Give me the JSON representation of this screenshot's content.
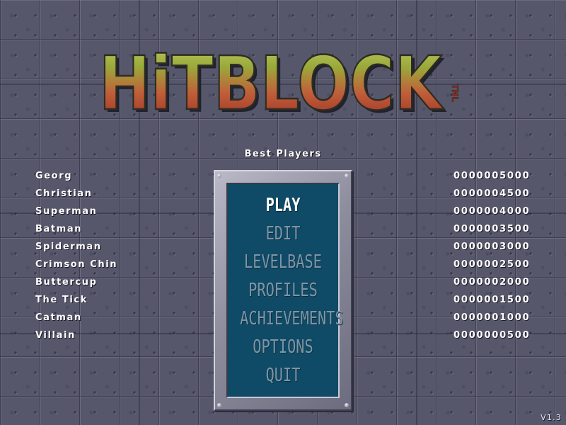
{
  "game": {
    "title": "HiTBLOCK",
    "tag": "TNL",
    "version": "V1.3"
  },
  "highscores": {
    "title": "Best Players",
    "entries": [
      {
        "name": "Georg",
        "score": "0000005000"
      },
      {
        "name": "Christian",
        "score": "0000004500"
      },
      {
        "name": "Superman",
        "score": "0000004000"
      },
      {
        "name": "Batman",
        "score": "0000003500"
      },
      {
        "name": "Spiderman",
        "score": "0000003000"
      },
      {
        "name": "Crimson Chin",
        "score": "0000002500"
      },
      {
        "name": "Buttercup",
        "score": "0000002000"
      },
      {
        "name": "The Tick",
        "score": "0000001500"
      },
      {
        "name": "Catman",
        "score": "0000001000"
      },
      {
        "name": "Villain",
        "score": "0000000500"
      }
    ]
  },
  "menu": {
    "items": [
      {
        "label": "PLAY",
        "active": true
      },
      {
        "label": "EDIT",
        "active": false
      },
      {
        "label": "LEVELBASE",
        "active": false
      },
      {
        "label": "PROFILES",
        "active": false
      },
      {
        "label": "ACHIEVEMENTS",
        "active": false
      },
      {
        "label": "OPTIONS",
        "active": false
      },
      {
        "label": "QUIT",
        "active": false
      }
    ]
  },
  "colors": {
    "logo_top": "#9aab3a",
    "logo_bottom": "#b0302a",
    "menu_panel": "#0f4a66",
    "menu_active": "#ffffff",
    "menu_inactive": "#7e95a5",
    "background": "#57576c"
  }
}
